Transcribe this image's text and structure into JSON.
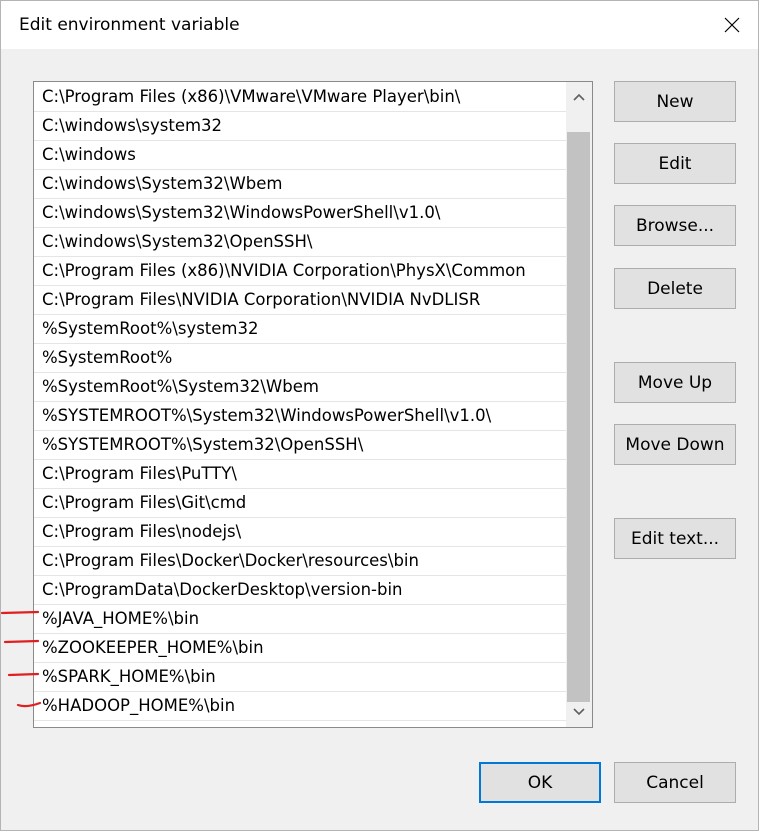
{
  "window": {
    "title": "Edit environment variable"
  },
  "list": {
    "items": [
      "C:\\Program Files (x86)\\VMware\\VMware Player\\bin\\",
      "C:\\windows\\system32",
      "C:\\windows",
      "C:\\windows\\System32\\Wbem",
      "C:\\windows\\System32\\WindowsPowerShell\\v1.0\\",
      "C:\\windows\\System32\\OpenSSH\\",
      "C:\\Program Files (x86)\\NVIDIA Corporation\\PhysX\\Common",
      "C:\\Program Files\\NVIDIA Corporation\\NVIDIA NvDLISR",
      "%SystemRoot%\\system32",
      "%SystemRoot%",
      "%SystemRoot%\\System32\\Wbem",
      "%SYSTEMROOT%\\System32\\WindowsPowerShell\\v1.0\\",
      "%SYSTEMROOT%\\System32\\OpenSSH\\",
      "C:\\Program Files\\PuTTY\\",
      "C:\\Program Files\\Git\\cmd",
      "C:\\Program Files\\nodejs\\",
      "C:\\Program Files\\Docker\\Docker\\resources\\bin",
      "C:\\ProgramData\\DockerDesktop\\version-bin",
      "%JAVA_HOME%\\bin",
      "%ZOOKEEPER_HOME%\\bin",
      "%SPARK_HOME%\\bin",
      "%HADOOP_HOME%\\bin"
    ]
  },
  "buttons": {
    "new": "New",
    "edit": "Edit",
    "browse": "Browse...",
    "delete": "Delete",
    "move_up": "Move Up",
    "move_down": "Move Down",
    "edit_text": "Edit text...",
    "ok": "OK",
    "cancel": "Cancel"
  },
  "colors": {
    "accent": "#0078d7",
    "annotation": "#e02020"
  }
}
